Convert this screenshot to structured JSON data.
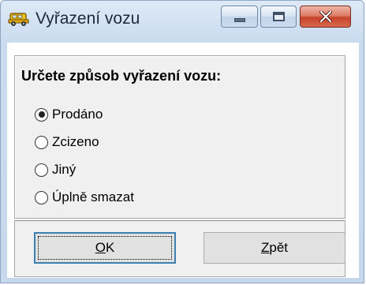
{
  "window": {
    "title": "Vyřazení vozu",
    "app_icon": "yellow-car-icon",
    "controls": {
      "minimize_icon": "minimize-icon",
      "maximize_icon": "maximize-icon",
      "close_icon": "close-icon",
      "close_color": "#c7432a"
    }
  },
  "dialog": {
    "prompt": "Určete způsob vyřazení vozu:",
    "options": [
      {
        "label": "Prodáno",
        "selected": true
      },
      {
        "label": "Zcizeno",
        "selected": false
      },
      {
        "label": "Jiný",
        "selected": false
      },
      {
        "label": "Úplně smazat",
        "selected": false
      }
    ]
  },
  "buttons": {
    "ok": {
      "mnemonic": "O",
      "rest": "K"
    },
    "back": {
      "mnemonic": "Z",
      "rest": "pět"
    }
  }
}
